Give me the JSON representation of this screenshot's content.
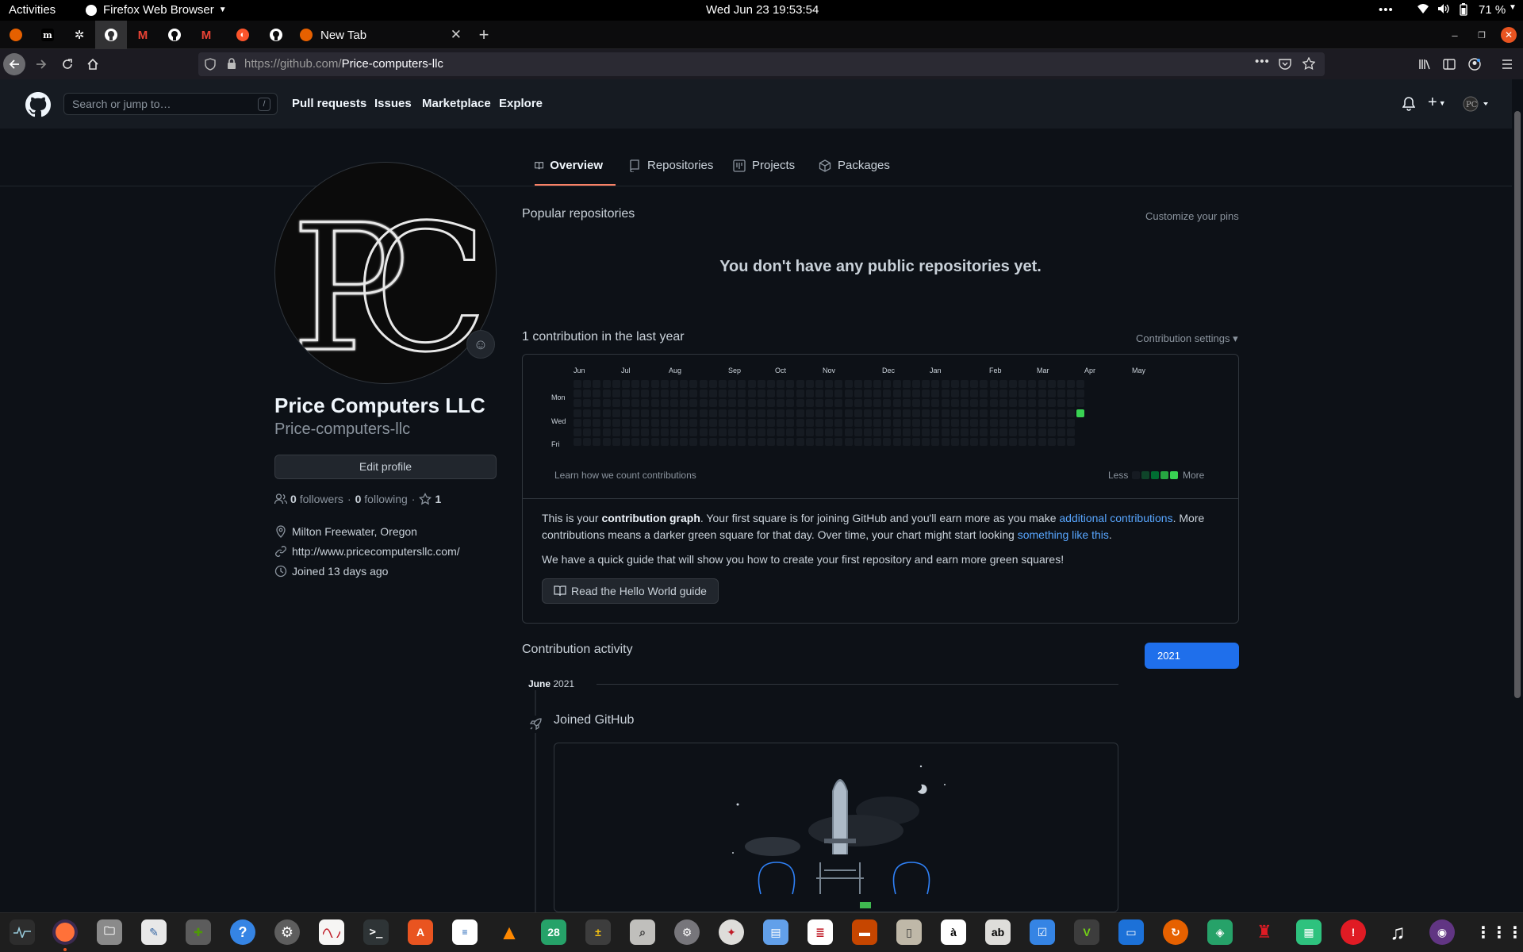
{
  "topbar": {
    "activities": "Activities",
    "app_menu": "Firefox Web Browser",
    "clock": "Wed Jun 23  19:53:54",
    "battery": "71 %"
  },
  "browser": {
    "active_tab_title": "New Tab",
    "url_host": "https://github.com/",
    "url_path": "Price-computers-llc"
  },
  "github_header": {
    "search_placeholder": "Search or jump to…",
    "search_shortcut": "/",
    "nav": [
      "Pull requests",
      "Issues",
      "Marketplace",
      "Explore"
    ]
  },
  "profile_tabs": [
    "Overview",
    "Repositories",
    "Projects",
    "Packages"
  ],
  "profile": {
    "display_name": "Price Computers LLC",
    "login": "Price-computers-llc",
    "edit_button": "Edit profile",
    "followers_count": "0",
    "followers_label": "followers",
    "following_count": "0",
    "following_label": "following",
    "stars_count": "1",
    "location": "Milton Freewater, Oregon",
    "website": "http://www.pricecomputersllc.com/",
    "joined": "Joined 13 days ago"
  },
  "popular": {
    "title": "Popular repositories",
    "customize": "Customize your pins",
    "empty": "You don't have any public repositories yet."
  },
  "contributions": {
    "title": "1 contribution in the last year",
    "settings": "Contribution settings ▾",
    "months": [
      "Jun",
      "Jul",
      "Aug",
      "Sep",
      "Oct",
      "Nov",
      "Dec",
      "Jan",
      "Feb",
      "Mar",
      "Apr",
      "May"
    ],
    "day_labels": [
      "Mon",
      "Wed",
      "Fri"
    ],
    "learn_link": "Learn how we count contributions",
    "legend_less": "Less",
    "legend_more": "More",
    "legend_colors": [
      "#161b22",
      "#0e4429",
      "#006d32",
      "#26a641",
      "#39d353"
    ],
    "active_color": "#39d353",
    "info_pre": "This is your ",
    "info_bold": "contribution graph",
    "info_mid": ". Your first square is for joining GitHub and you'll earn more as you make ",
    "info_link1": "additional contributions",
    "info_mid2": ". More contributions means a darker green square for that day. Over time, your chart might start looking ",
    "info_link2": "something like this",
    "info_end": ".",
    "guide_text": "We have a quick guide that will show you how to create your first repository and earn more green squares!",
    "guide_button": "Read the Hello World guide"
  },
  "activity": {
    "title": "Contribution activity",
    "year": "2021",
    "month": "June",
    "month_year": "2021",
    "event": "Joined GitHub"
  }
}
